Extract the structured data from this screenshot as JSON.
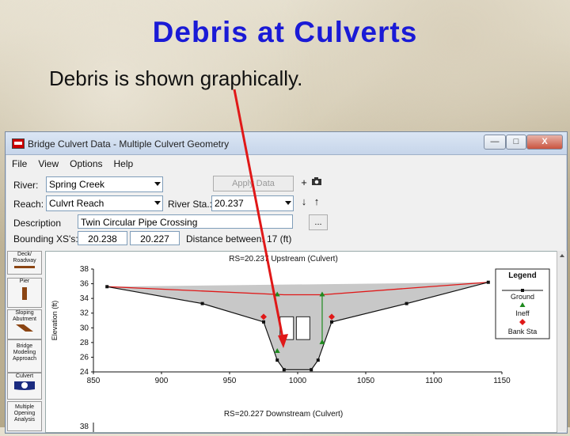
{
  "slide": {
    "title": "Debris at Culverts",
    "subtitle": "Debris is shown graphically."
  },
  "window": {
    "title": "Bridge Culvert Data - Multiple Culvert Geometry",
    "min_label": "—",
    "max_label": "□",
    "close_label": "X"
  },
  "menu": [
    "File",
    "View",
    "Options",
    "Help"
  ],
  "form": {
    "river_label": "River:",
    "river_value": "Spring Creek",
    "reach_label": "Reach:",
    "reach_value": "Culvrt Reach",
    "river_sta_label": "River Sta.:",
    "river_sta_value": "20.237",
    "apply_label": "Apply Data",
    "description_label": "Description",
    "description_value": "Twin Circular Pipe Crossing",
    "more_label": "...",
    "bounding_label": "Bounding XS's:",
    "bounding_up": "20.238",
    "bounding_down": "20.227",
    "distance_label": "Distance between:",
    "distance_value": "17 (ft)",
    "add_label": "+",
    "down_label": "↓",
    "up_label": "↑"
  },
  "editors": [
    {
      "label": "Deck/ Roadway"
    },
    {
      "label": "Pier"
    },
    {
      "label": "Sloping Abutment"
    },
    {
      "label": "Bridge Modeling Approach"
    },
    {
      "label": "Culvert"
    },
    {
      "label": "Multiple Opening Analysis"
    }
  ],
  "chart_data": {
    "type": "line",
    "title": "RS=20.237  Upstream (Culvert)",
    "second_title": "RS=20.227  Downstream (Culvert)",
    "second_top_tick": "38",
    "xlabel": "",
    "ylabel": "Elevation (ft)",
    "xlim": [
      850,
      1150
    ],
    "ylim": [
      24,
      38
    ],
    "x_ticks": [
      "850",
      "900",
      "950",
      "1000",
      "1050",
      "1100",
      "1150"
    ],
    "y_ticks": [
      "38",
      "36",
      "34",
      "32",
      "30",
      "28",
      "26",
      "24"
    ],
    "legend": {
      "title": "Legend",
      "entries": [
        "Ground",
        "Ineff",
        "Bank Sta"
      ],
      "position": "right"
    },
    "series": [
      {
        "name": "Ground",
        "points": [
          [
            860,
            35.6
          ],
          [
            930,
            33.3
          ],
          [
            975,
            30.8
          ],
          [
            985,
            25.6
          ],
          [
            990,
            24.3
          ],
          [
            1010,
            24.3
          ],
          [
            1015,
            25.6
          ],
          [
            1025,
            30.8
          ],
          [
            1080,
            33.3
          ],
          [
            1140,
            36.2
          ]
        ]
      },
      {
        "name": "Ineff",
        "points": [
          [
            985,
            34.5
          ],
          [
            1018,
            34.5
          ],
          [
            985,
            26.8
          ],
          [
            1018,
            28.0
          ]
        ]
      },
      {
        "name": "Bank Sta",
        "points": [
          [
            975,
            31.5
          ],
          [
            1025,
            31.5
          ]
        ]
      }
    ],
    "colors": {
      "ground": "#111111",
      "fill": "#c8c8c8",
      "ineff": "#1e8a1e",
      "bank": "#e01818",
      "topline": "#e01818",
      "annotation": "#e01818"
    }
  }
}
